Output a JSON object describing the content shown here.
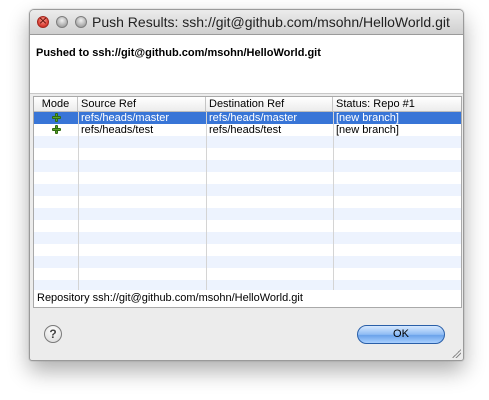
{
  "window": {
    "title": "Push Results: ssh://git@github.com/msohn/HelloWorld.git"
  },
  "message": "Pushed to ssh://git@github.com/msohn/HelloWorld.git",
  "table": {
    "columns": [
      "Mode",
      "Source Ref",
      "Destination Ref",
      "Status: Repo #1"
    ],
    "rows": [
      {
        "mode_icon": "plus-icon",
        "source": "refs/heads/master",
        "destination": "refs/heads/master",
        "status": "[new branch]",
        "selected": true
      },
      {
        "mode_icon": "plus-icon",
        "source": "refs/heads/test",
        "destination": "refs/heads/test",
        "status": "[new branch]",
        "selected": false
      }
    ]
  },
  "footer": {
    "repository": "Repository ssh://git@github.com/msohn/HelloWorld.git"
  },
  "buttons": {
    "help_icon": "question-mark-icon",
    "help_label": "?",
    "ok_label": "OK"
  },
  "colors": {
    "selection": "#3875d7",
    "stripe": "#edf3fe",
    "add_icon": "#5aa628"
  }
}
